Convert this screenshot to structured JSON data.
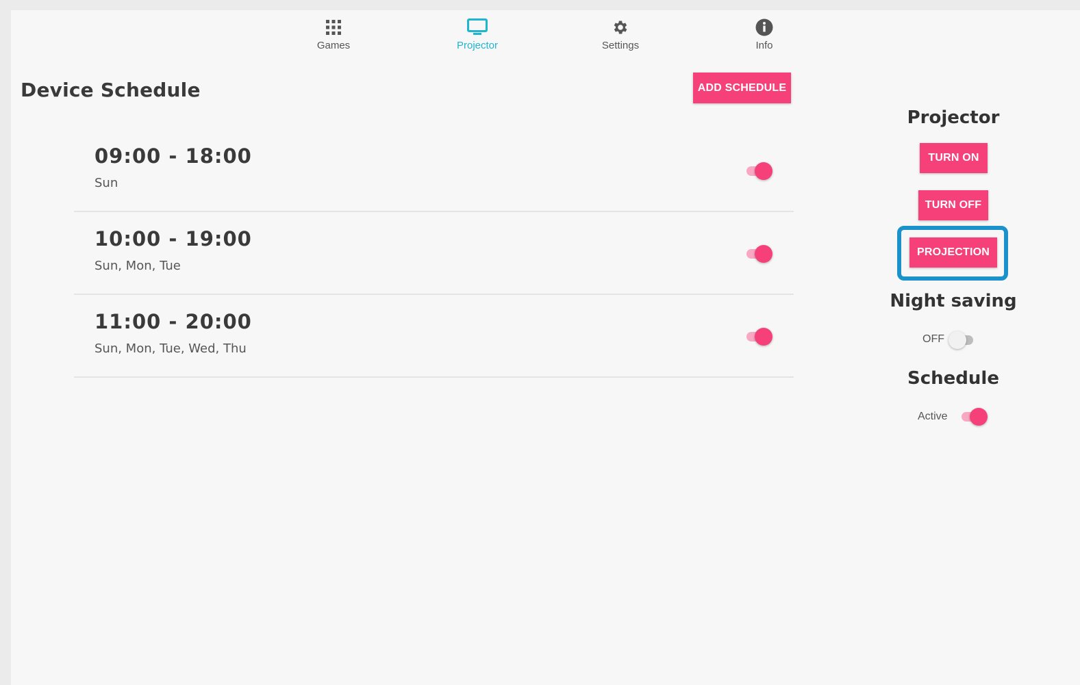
{
  "nav": {
    "items": [
      {
        "label": "Games",
        "icon": "grid-icon"
      },
      {
        "label": "Projector",
        "icon": "monitor-icon"
      },
      {
        "label": "Settings",
        "icon": "gear-icon"
      },
      {
        "label": "Info",
        "icon": "info-icon"
      }
    ],
    "active_index": 1
  },
  "page_title": "Device Schedule",
  "add_button_label": "ADD SCHEDULE",
  "schedules": [
    {
      "time": "09:00 - 18:00",
      "days": "Sun",
      "enabled": true
    },
    {
      "time": "10:00 - 19:00",
      "days": "Sun, Mon, Tue",
      "enabled": true
    },
    {
      "time": "11:00 - 20:00",
      "days": "Sun, Mon, Tue, Wed, Thu",
      "enabled": true
    }
  ],
  "panel": {
    "projector_heading": "Projector",
    "turn_on_label": "TURN ON",
    "turn_off_label": "TURN OFF",
    "projection_label": "PROJECTION",
    "night_saving_heading": "Night saving",
    "night_saving_state": "OFF",
    "night_saving_enabled": false,
    "schedule_heading": "Schedule",
    "schedule_state": "Active",
    "schedule_enabled": true
  },
  "colors": {
    "accent_pink": "#f5407a",
    "active_tab": "#1fb5d0",
    "highlight_border": "#1b92c9"
  }
}
